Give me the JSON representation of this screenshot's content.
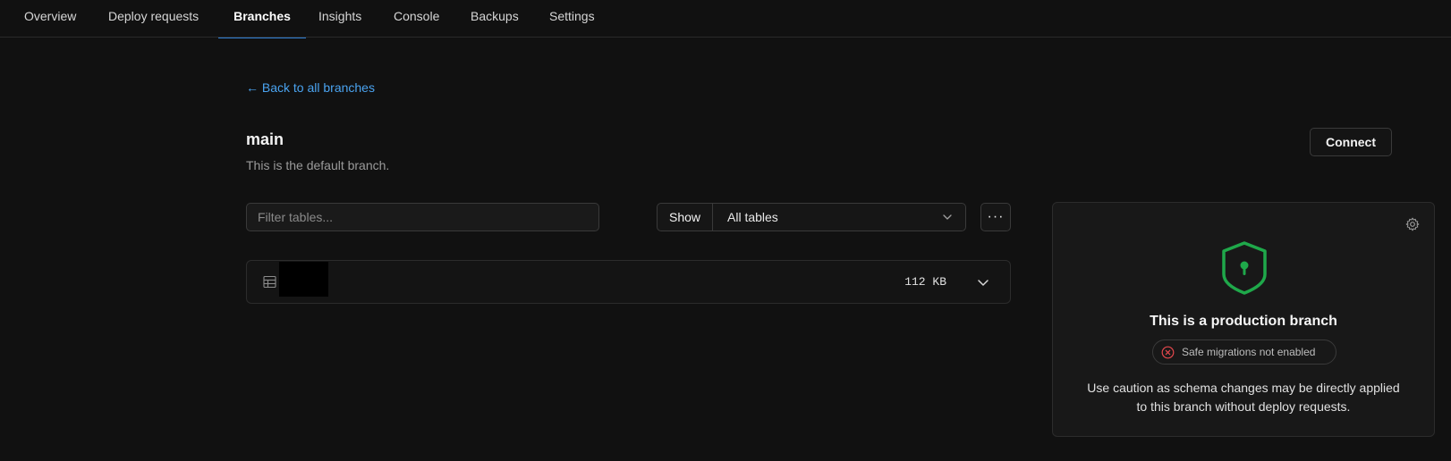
{
  "nav": {
    "tabs": [
      {
        "label": "Overview"
      },
      {
        "label": "Deploy requests"
      },
      {
        "label": "Branches",
        "active": true
      },
      {
        "label": "Insights"
      },
      {
        "label": "Console"
      },
      {
        "label": "Backups"
      },
      {
        "label": "Settings"
      }
    ]
  },
  "back_link": "← Back to all branches",
  "branch": {
    "name": "main",
    "description": "This is the default branch."
  },
  "connect_label": "Connect",
  "filter": {
    "placeholder": "Filter tables...",
    "value": ""
  },
  "show": {
    "label": "Show",
    "selected": "All tables"
  },
  "more_label": "···",
  "tables": [
    {
      "name": "",
      "size": "112 KB",
      "icon": "table-icon"
    }
  ],
  "production": {
    "title": "This is a production branch",
    "badge": "Safe migrations not enabled",
    "description_line1": "Use caution as schema changes may be directly applied",
    "description_line2": "to this branch without deploy requests.",
    "shield_color": "#1fa84a",
    "badge_icon_color": "#e5484d",
    "icons": [
      "gear-icon",
      "shield-icon",
      "x-circle-icon"
    ]
  },
  "colors": {
    "background": "#111111",
    "link": "#4aa3f0",
    "active_tab_underline": "#2f7fd6"
  }
}
